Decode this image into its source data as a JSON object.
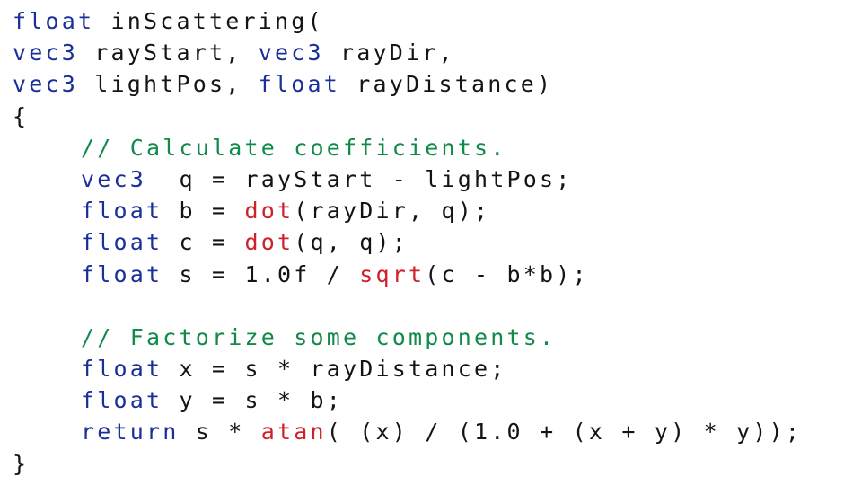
{
  "colors": {
    "keyword": "#1b2f99",
    "comment": "#118a4a",
    "builtin_function": "#d0202a",
    "plain": "#141414",
    "background": "#ffffff"
  },
  "code": {
    "lines": [
      {
        "indent": 0,
        "tokens": [
          {
            "type": "keyword",
            "text": "float"
          },
          {
            "type": "plain",
            "text": " inScattering("
          }
        ]
      },
      {
        "indent": 0,
        "tokens": [
          {
            "type": "keyword",
            "text": "vec3"
          },
          {
            "type": "plain",
            "text": " rayStart, "
          },
          {
            "type": "keyword",
            "text": "vec3"
          },
          {
            "type": "plain",
            "text": " rayDir,"
          }
        ]
      },
      {
        "indent": 0,
        "tokens": [
          {
            "type": "keyword",
            "text": "vec3"
          },
          {
            "type": "plain",
            "text": " lightPos, "
          },
          {
            "type": "keyword",
            "text": "float"
          },
          {
            "type": "plain",
            "text": " rayDistance)"
          }
        ]
      },
      {
        "indent": 0,
        "tokens": [
          {
            "type": "plain",
            "text": "{"
          }
        ]
      },
      {
        "indent": 1,
        "tokens": [
          {
            "type": "comment",
            "text": "// Calculate coefficients."
          }
        ]
      },
      {
        "indent": 1,
        "tokens": [
          {
            "type": "keyword",
            "text": "vec3"
          },
          {
            "type": "plain",
            "text": "  q = rayStart - lightPos;"
          }
        ]
      },
      {
        "indent": 1,
        "tokens": [
          {
            "type": "keyword",
            "text": "float"
          },
          {
            "type": "plain",
            "text": " b = "
          },
          {
            "type": "func",
            "text": "dot"
          },
          {
            "type": "plain",
            "text": "(rayDir, q);"
          }
        ]
      },
      {
        "indent": 1,
        "tokens": [
          {
            "type": "keyword",
            "text": "float"
          },
          {
            "type": "plain",
            "text": " c = "
          },
          {
            "type": "func",
            "text": "dot"
          },
          {
            "type": "plain",
            "text": "(q, q);"
          }
        ]
      },
      {
        "indent": 1,
        "tokens": [
          {
            "type": "keyword",
            "text": "float"
          },
          {
            "type": "plain",
            "text": " s = 1.0f / "
          },
          {
            "type": "func",
            "text": "sqrt"
          },
          {
            "type": "plain",
            "text": "(c - b*b);"
          }
        ]
      },
      {
        "indent": 0,
        "tokens": []
      },
      {
        "indent": 1,
        "tokens": [
          {
            "type": "comment",
            "text": "// Factorize some components."
          }
        ]
      },
      {
        "indent": 1,
        "tokens": [
          {
            "type": "keyword",
            "text": "float"
          },
          {
            "type": "plain",
            "text": " x = s * rayDistance;"
          }
        ]
      },
      {
        "indent": 1,
        "tokens": [
          {
            "type": "keyword",
            "text": "float"
          },
          {
            "type": "plain",
            "text": " y = s * b;"
          }
        ]
      },
      {
        "indent": 1,
        "tokens": [
          {
            "type": "keyword",
            "text": "return"
          },
          {
            "type": "plain",
            "text": " s * "
          },
          {
            "type": "func",
            "text": "atan"
          },
          {
            "type": "plain",
            "text": "( (x) / (1.0 + (x + y) * y));"
          }
        ]
      },
      {
        "indent": 0,
        "tokens": [
          {
            "type": "plain",
            "text": "}"
          }
        ]
      }
    ]
  }
}
